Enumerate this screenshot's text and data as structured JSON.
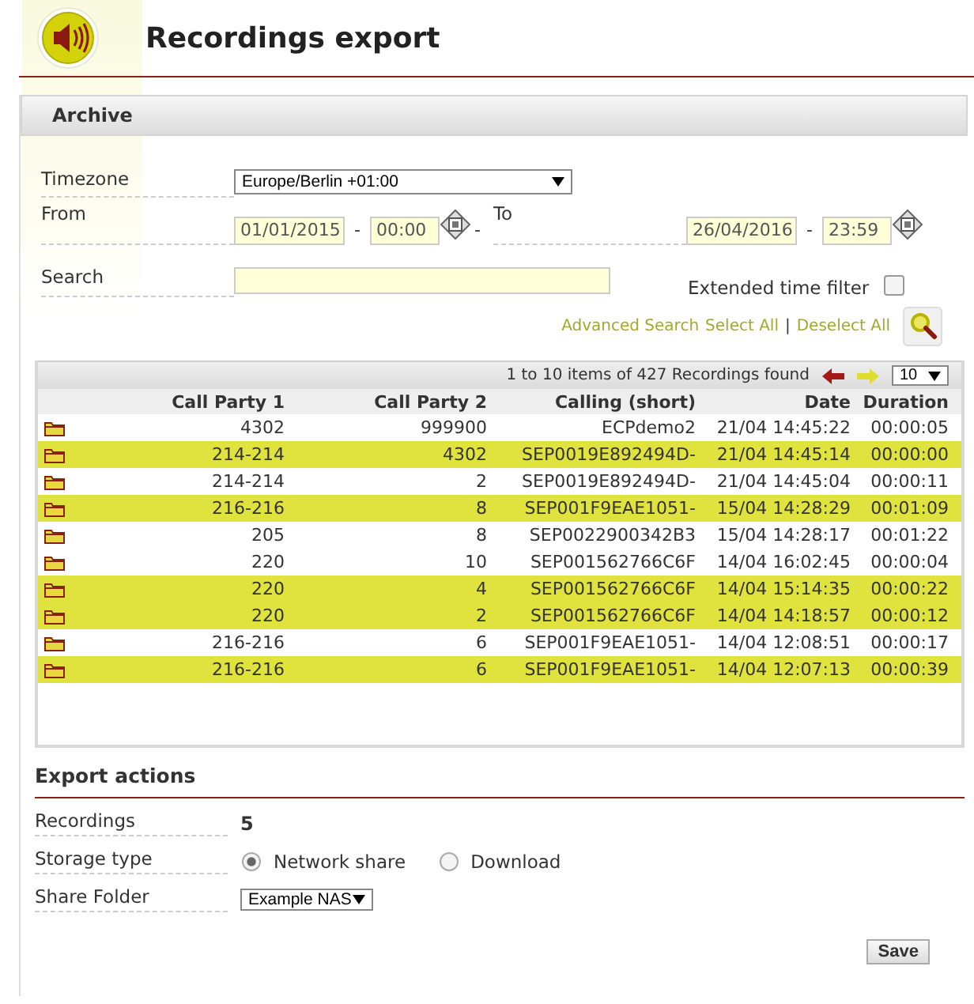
{
  "header": {
    "title": "Recordings export"
  },
  "archive": {
    "title": "Archive",
    "timezone": {
      "label": "Timezone",
      "value": "Europe/Berlin +01:00"
    },
    "from": {
      "label": "From",
      "date": "01/01/2015",
      "separator": "-",
      "time": "00:00",
      "separator_after": "-"
    },
    "to": {
      "label": "To",
      "date": "26/04/2016",
      "separator": "-",
      "time": "23:59"
    },
    "search": {
      "label": "Search"
    },
    "extended_time_filter": {
      "label": "Extended time filter",
      "checked": false
    },
    "links": [
      "Advanced Search",
      "Select All",
      "Deselect All"
    ],
    "link_separator": "|"
  },
  "table": {
    "summary": "1 to 10 items of 427 Recordings found",
    "page_size": "10",
    "columns": [
      "Call Party 1",
      "Call Party 2",
      "Calling (short)",
      "Date",
      "Duration"
    ],
    "rows": [
      {
        "cells": [
          "4302",
          "999900",
          "ECPdemo2",
          "21/04 14:45:22",
          "00:00:05"
        ],
        "selected": false
      },
      {
        "cells": [
          "214-214",
          "4302",
          "SEP0019E892494D-",
          "21/04 14:45:14",
          "00:00:00"
        ],
        "selected": true
      },
      {
        "cells": [
          "214-214",
          "2",
          "SEP0019E892494D-",
          "21/04 14:45:04",
          "00:00:11"
        ],
        "selected": false
      },
      {
        "cells": [
          "216-216",
          "8",
          "SEP001F9EAE1051-",
          "15/04 14:28:29",
          "00:01:09"
        ],
        "selected": true
      },
      {
        "cells": [
          "205",
          "8",
          "SEP0022900342B3",
          "15/04 14:28:17",
          "00:01:22"
        ],
        "selected": false
      },
      {
        "cells": [
          "220",
          "10",
          "SEP001562766C6F",
          "14/04 16:02:45",
          "00:00:04"
        ],
        "selected": false
      },
      {
        "cells": [
          "220",
          "4",
          "SEP001562766C6F",
          "14/04 15:14:35",
          "00:00:22"
        ],
        "selected": true
      },
      {
        "cells": [
          "220",
          "2",
          "SEP001562766C6F",
          "14/04 14:18:57",
          "00:00:12"
        ],
        "selected": true
      },
      {
        "cells": [
          "216-216",
          "6",
          "SEP001F9EAE1051-",
          "14/04 12:08:51",
          "00:00:17"
        ],
        "selected": false
      },
      {
        "cells": [
          "216-216",
          "6",
          "SEP001F9EAE1051-",
          "14/04 12:07:13",
          "00:00:39"
        ],
        "selected": true
      }
    ]
  },
  "export": {
    "title": "Export actions",
    "recordings": {
      "label": "Recordings",
      "value": "5"
    },
    "storage_type": {
      "label": "Storage type",
      "options": [
        {
          "label": "Network share",
          "selected": true
        },
        {
          "label": "Download",
          "selected": false
        }
      ]
    },
    "share_folder": {
      "label": "Share Folder",
      "value": "Example NAS"
    },
    "save": "Save"
  }
}
